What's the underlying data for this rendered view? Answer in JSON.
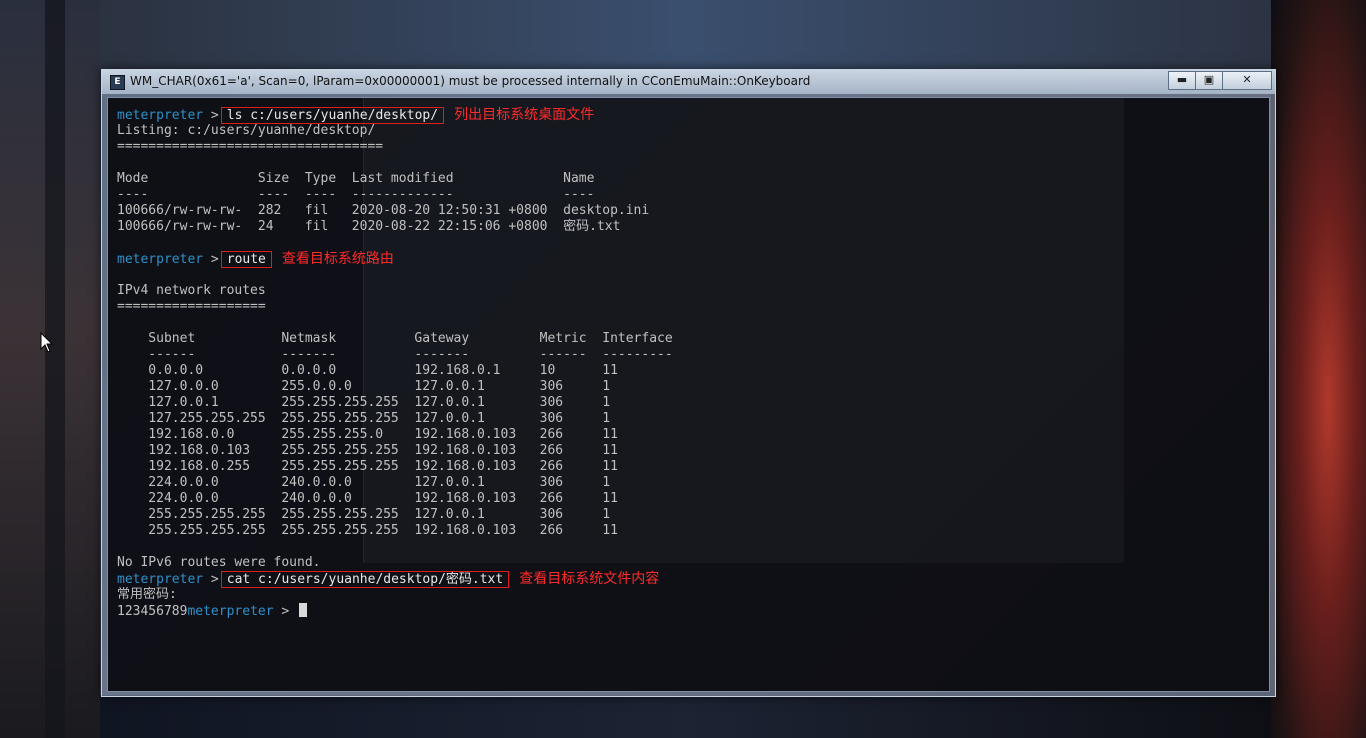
{
  "window": {
    "title": "WM_CHAR(0x61='a', Scan=0, lParam=0x00000001) must be processed internally in CConEmuMain::OnKeyboard",
    "minimize": "▬",
    "maximize": "▣",
    "close": "✕"
  },
  "prompt": "meterpreter",
  "chevron": ">",
  "console": {
    "cmd1": "ls c:/users/yuanhe/desktop/",
    "note1": "列出目标系统桌面文件",
    "listing": "Listing: c:/users/yuanhe/desktop/",
    "sep1": "==================================",
    "table_header": "Mode              Size  Type  Last modified              Name",
    "table_dash": "----              ----  ----  -------------              ----",
    "file_rows": [
      "100666/rw-rw-rw-  282   fil   2020-08-20 12:50:31 +0800  desktop.ini",
      "100666/rw-rw-rw-  24    fil   2020-08-22 22:15:06 +0800  密码.txt"
    ],
    "cmd2": "route",
    "note2": "查看目标系统路由",
    "ipv4_title": "IPv4 network routes",
    "sep2": "===================",
    "route_header": "    Subnet           Netmask          Gateway         Metric  Interface",
    "route_dash": "    ------           -------          -------         ------  ---------",
    "routes": [
      "    0.0.0.0          0.0.0.0          192.168.0.1     10      11",
      "    127.0.0.0        255.0.0.0        127.0.0.1       306     1",
      "    127.0.0.1        255.255.255.255  127.0.0.1       306     1",
      "    127.255.255.255  255.255.255.255  127.0.0.1       306     1",
      "    192.168.0.0      255.255.255.0    192.168.0.103   266     11",
      "    192.168.0.103    255.255.255.255  192.168.0.103   266     11",
      "    192.168.0.255    255.255.255.255  192.168.0.103   266     11",
      "    224.0.0.0        240.0.0.0        127.0.0.1       306     1",
      "    224.0.0.0        240.0.0.0        192.168.0.103   266     11",
      "    255.255.255.255  255.255.255.255  127.0.0.1       306     1",
      "    255.255.255.255  255.255.255.255  192.168.0.103   266     11"
    ],
    "no_ipv6": "No IPv6 routes were found.",
    "cmd3": "cat c:/users/yuanhe/desktop/密码.txt",
    "note3": "查看目标系统文件内容",
    "file_line1": "常用密码:",
    "file_line2": "123456789"
  },
  "colors": {
    "prompt": "#2f8fc9",
    "annotation": "#ff2a2a",
    "text": "#c0c0c0"
  }
}
